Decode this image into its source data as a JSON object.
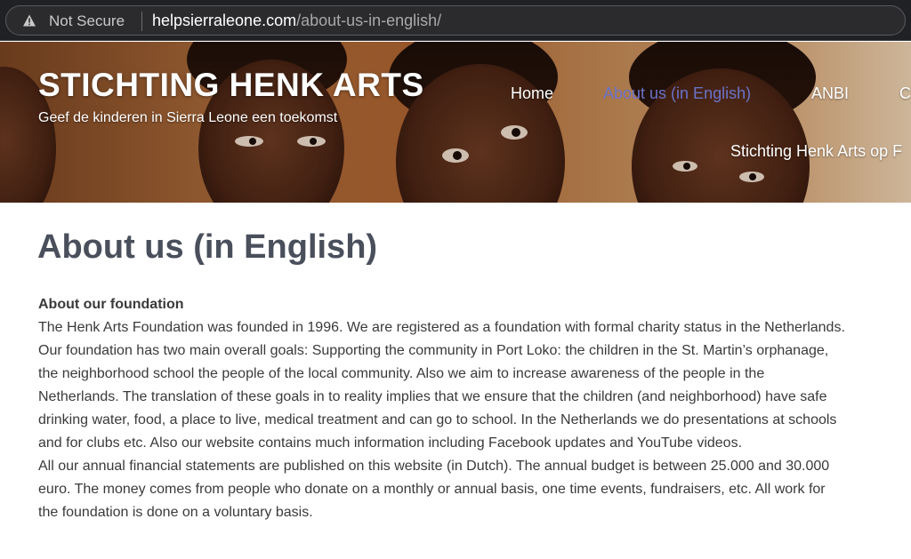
{
  "browser": {
    "security_label": "Not Secure",
    "url_host": "helpsierraleone.com",
    "url_path": "/about-us-in-english/"
  },
  "site": {
    "title": "STICHTING HENK ARTS",
    "tagline": "Geef de kinderen in Sierra Leone een toekomst"
  },
  "nav": {
    "home": "Home",
    "about": "About us (in English)",
    "anbi": "ANBI",
    "more": "C",
    "facebook": "Stichting Henk Arts op F",
    "active_color": "#6a73c9"
  },
  "page": {
    "title": "About us (in English)",
    "section_heading": "About our foundation",
    "lines": [
      "The Henk Arts Foundation was founded in 1996. We are registered as a foundation with formal charity status in the Netherlands.",
      "Our foundation has two main overall goals: Supporting the community in Port Loko: the children in the St. Martin’s orphanage,",
      "the neighborhood school the people of the local community. Also we aim to increase awareness of the people in the",
      "Netherlands. The translation of these goals in to reality implies that we ensure that the children (and neighborhood) have safe",
      "drinking water, food, a place to live, medical treatment and can go to school. In the Netherlands we do presentations at schools",
      "and for clubs etc. Also our website contains much information including Facebook updates and YouTube videos.",
      "All our annual financial statements are published on this website (in Dutch). The annual budget is between 25.000 and 30.000",
      "euro. The money comes from people who donate on a monthly or annual basis, one time events, fundraisers, etc. All work for",
      "the foundation is done on a voluntary basis."
    ]
  },
  "icons": {
    "security": "warning-triangle-icon"
  }
}
